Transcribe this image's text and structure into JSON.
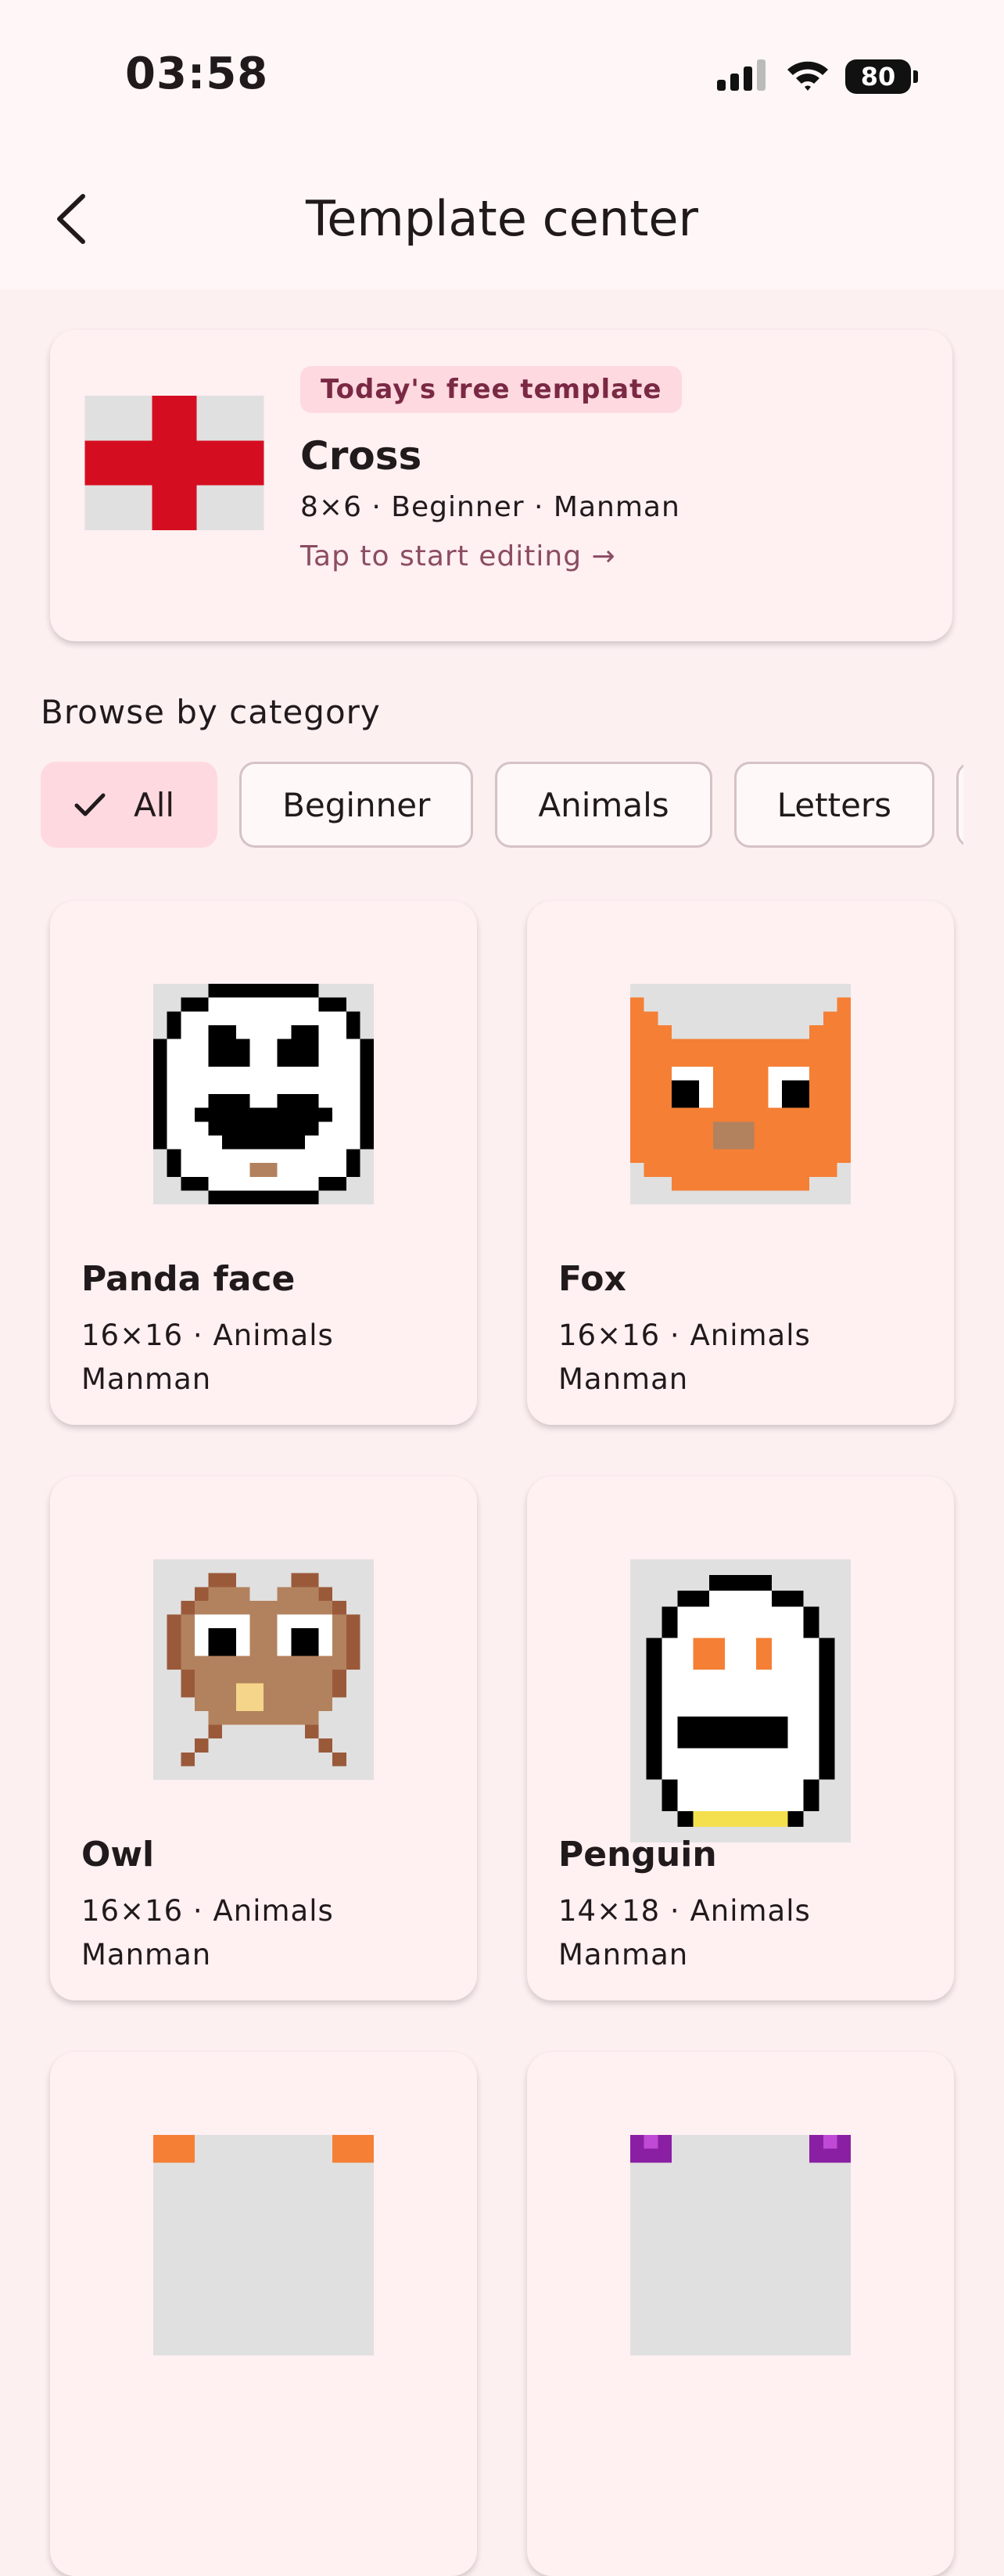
{
  "status": {
    "time": "03:58",
    "battery": "80"
  },
  "appbar": {
    "title": "Template center"
  },
  "featured": {
    "badge": "Today's free template",
    "title": "Cross",
    "meta": "8×6 · Beginner · Manman",
    "cta": "Tap to start editing →"
  },
  "browse": {
    "label": "Browse by category",
    "chips": [
      {
        "label": "All",
        "selected": true
      },
      {
        "label": "Beginner"
      },
      {
        "label": "Animals"
      },
      {
        "label": "Letters"
      }
    ]
  },
  "templates": [
    {
      "title": "Panda face",
      "meta": "16×16 · Animals",
      "author": "Manman"
    },
    {
      "title": "Fox",
      "meta": "16×16 · Animals",
      "author": "Manman"
    },
    {
      "title": "Owl",
      "meta": "16×16 · Animals",
      "author": "Manman"
    },
    {
      "title": "Penguin",
      "meta": "14×18 · Animals",
      "author": "Manman"
    }
  ],
  "colors": {
    "accent": "#ffd9e0",
    "cross_red": "#d40e20",
    "pixel_bg": "#e0e0e0",
    "fox_orange": "#f47f35",
    "owl_brown": "#b2825e",
    "penguin_orange": "#f47f35"
  }
}
